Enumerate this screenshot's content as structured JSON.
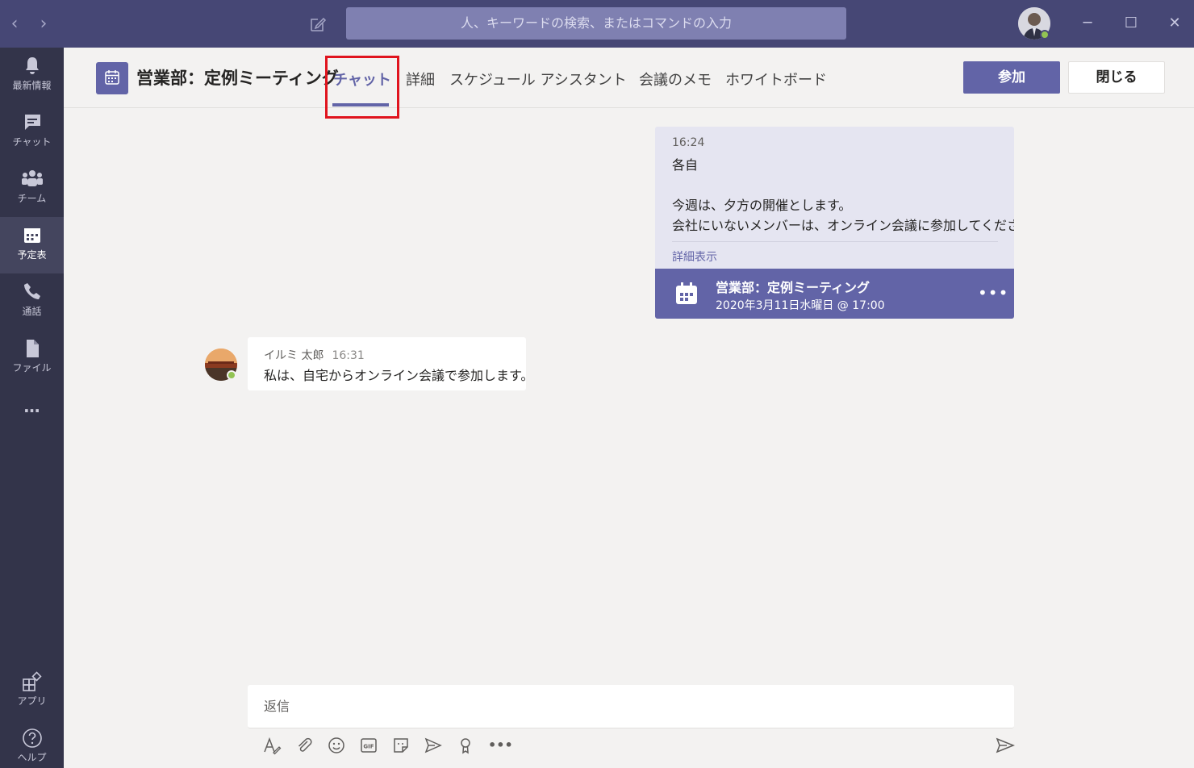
{
  "search": {
    "placeholder": "人、キーワードの検索、またはコマンドの入力"
  },
  "window": {
    "minimize": "─",
    "maximize": "☐",
    "close": "✕"
  },
  "nav": {
    "back": "‹",
    "forward": "›"
  },
  "rail": {
    "items": [
      {
        "label": "最新情報"
      },
      {
        "label": "チャット"
      },
      {
        "label": "チーム"
      },
      {
        "label": "予定表"
      },
      {
        "label": "通話"
      },
      {
        "label": "ファイル"
      },
      {
        "label": "…"
      },
      {
        "label": "アプリ"
      },
      {
        "label": "ヘルプ"
      }
    ]
  },
  "header": {
    "title": "営業部：定例ミーティング",
    "tabs": [
      {
        "label": "チャット"
      },
      {
        "label": "詳細"
      },
      {
        "label": "スケジュール アシスタント"
      },
      {
        "label": "会議のメモ"
      },
      {
        "label": "ホワイトボード"
      }
    ],
    "join_label": "参加",
    "close_label": "閉じる"
  },
  "card": {
    "time": "16:24",
    "line1": "各自",
    "line2": "今週は、夕方の開催とします。",
    "line3": "会社にいないメンバーは、オンライン会議に参加してください。",
    "more": "詳細表示",
    "footer_title": "営業部：定例ミーティング",
    "footer_date": "2020年3月11日水曜日 @ 17:00",
    "footer_more": "•••"
  },
  "message": {
    "author": "イルミ 太郎",
    "time": "16:31",
    "text": "私は、自宅からオンライン会議で参加します。"
  },
  "compose": {
    "placeholder": "返信",
    "more": "•••"
  },
  "colors": {
    "accent": "#6264a7",
    "titlebar": "#464775",
    "rail": "#33344a",
    "highlight": "#e0141e",
    "presence": "#92c353"
  }
}
